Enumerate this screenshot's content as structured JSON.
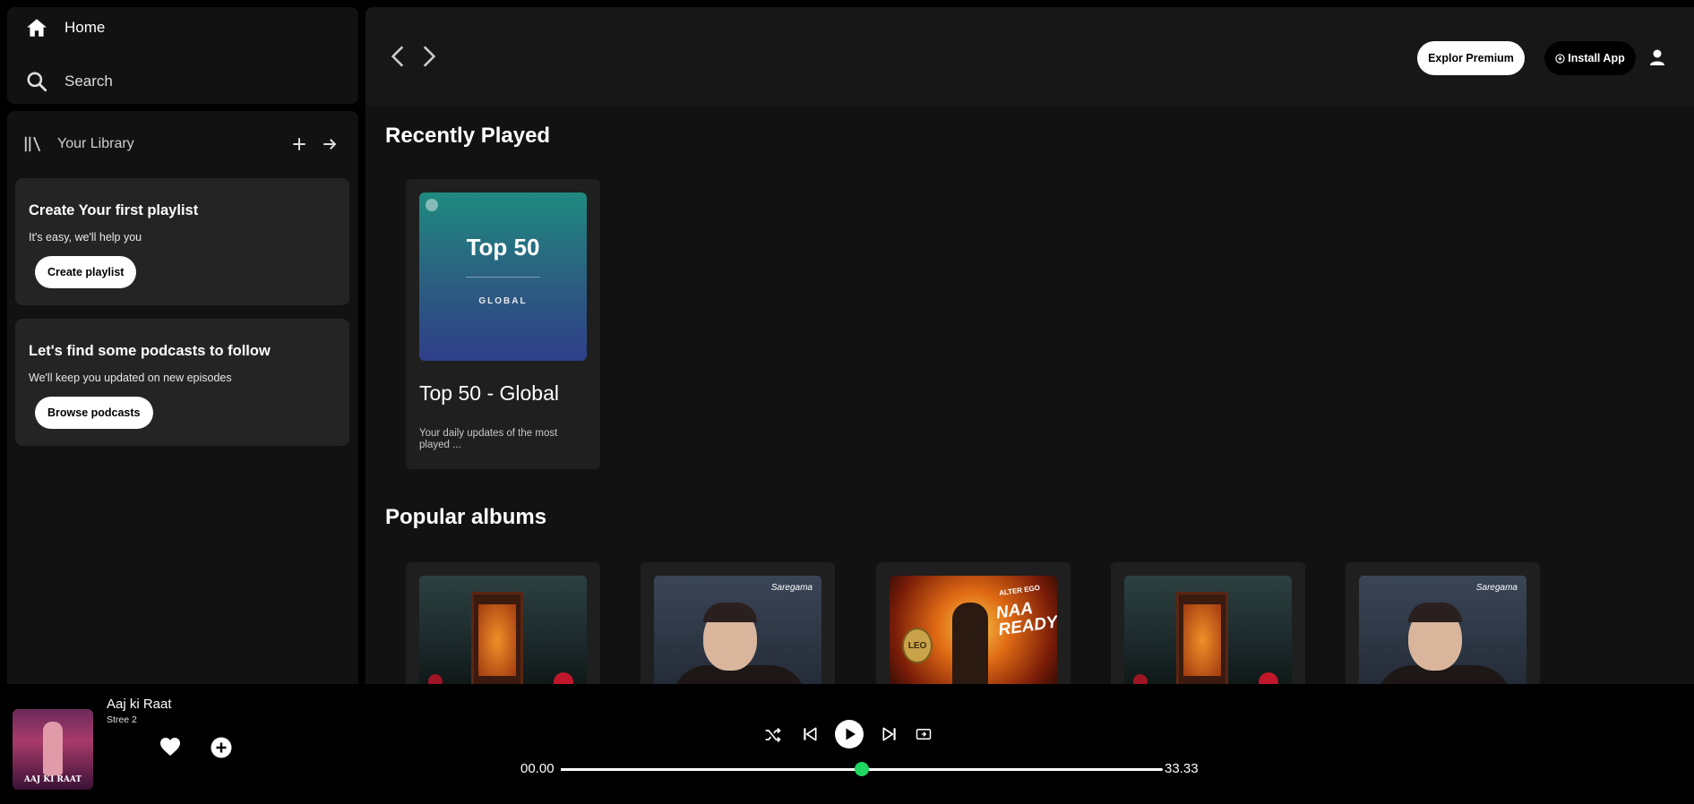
{
  "sidebar": {
    "home_label": "Home",
    "search_label": "Search"
  },
  "library": {
    "title": "Your Library",
    "cards": [
      {
        "heading": "Create Your first playlist",
        "text": "It's easy, we'll help you",
        "button": "Create playlist"
      },
      {
        "heading": "Let's find some podcasts to follow",
        "text": "We'll keep you updated on new episodes",
        "button": "Browse podcasts"
      }
    ]
  },
  "header": {
    "premium_label": "Explor Premium",
    "install_label": "Install App"
  },
  "sections": {
    "recent_title": "Recently Played",
    "popular_title": "Popular albums"
  },
  "recent": {
    "cover_title": "Top 50",
    "cover_subtitle": "GLOBAL",
    "title": "Top 50 - Global",
    "description": "Your daily updates of the most played ..."
  },
  "albums": [
    {
      "art": "phone-booth-art"
    },
    {
      "art": "portrait-art",
      "art_text": "Saregama"
    },
    {
      "art": "leo-art",
      "art_text_top": "ALTER EGO",
      "art_text_main": "NAA READY",
      "art_text_coin": "LEO"
    },
    {
      "art": "phone-booth-art"
    },
    {
      "art": "portrait-art",
      "art_text": "Saregama"
    }
  ],
  "now_playing": {
    "title": "Aaj ki Raat",
    "artist": "Stree 2",
    "art_text": "AAJ KI RAAT"
  },
  "playback": {
    "current_time": "00.00",
    "total_time": "33.33",
    "progress": 0.5
  },
  "colors": {
    "accent": "#1ed760",
    "panel": "#121212",
    "card": "#242424"
  }
}
